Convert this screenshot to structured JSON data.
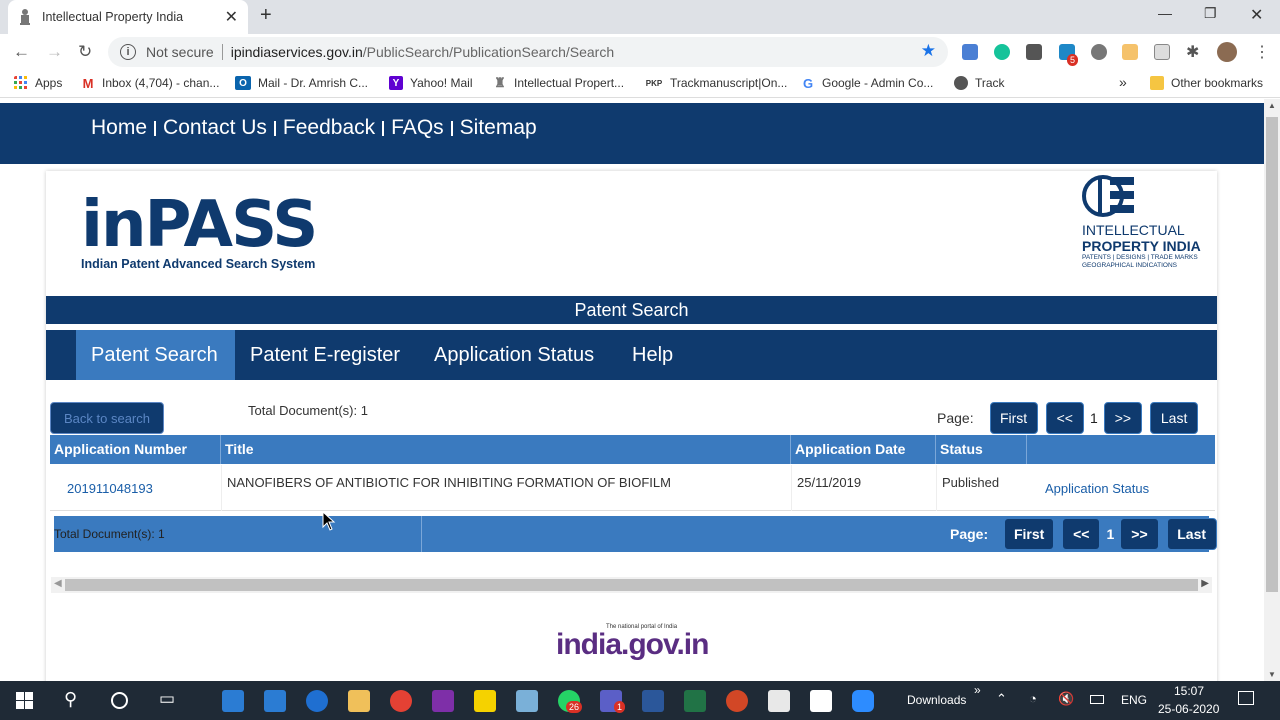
{
  "browser": {
    "tab_title": "Intellectual Property India",
    "new_tab": "+",
    "url_security": "Not secure",
    "url_host": "ipindiaservices.gov.in",
    "url_path": "/PublicSearch/PublicationSearch/Search",
    "ext_badge": "5",
    "bookmarks": [
      {
        "label": "Apps",
        "icon": "apps-grid-icon"
      },
      {
        "label": "Inbox (4,704) - chan...",
        "icon": "gmail-icon"
      },
      {
        "label": "Mail - Dr. Amrish C...",
        "icon": "outlook-icon"
      },
      {
        "label": "Yahoo! Mail",
        "icon": "yahoo-icon"
      },
      {
        "label": "Intellectual Propert...",
        "icon": "emblem-icon"
      },
      {
        "label": "Trackmanuscript|On...",
        "icon": "pkp-icon"
      },
      {
        "label": "Google - Admin Co...",
        "icon": "google-icon"
      },
      {
        "label": "Track",
        "icon": "globe-icon"
      }
    ],
    "more_bookmarks": "»",
    "other_bookmarks": "Other bookmarks"
  },
  "site": {
    "top_links": [
      "Home",
      "Contact Us",
      "Feedback",
      "FAQs",
      "Sitemap"
    ],
    "logo_title": "inPASS",
    "logo_subtitle": "Indian Patent Advanced Search System",
    "ipi_logo_line1": "INTELLECTUAL",
    "ipi_logo_line2": "PROPERTY INDIA",
    "ipi_logo_line3": "PATENTS | DESIGNS | TRADE MARKS",
    "ipi_logo_line4": "GEOGRAPHICAL INDICATIONS",
    "band_title": "Patent Search",
    "main_nav": [
      "Patent Search",
      "Patent E-register",
      "Application Status",
      "Help"
    ],
    "active_nav": "Patent Search",
    "back_button": "Back to search",
    "total_docs": "Total Document(s): 1",
    "pager": {
      "label": "Page:",
      "first": "First",
      "prev": "<<",
      "current": "1",
      "next": ">>",
      "last": "Last"
    },
    "table": {
      "headers": [
        "Application Number",
        "Title",
        "Application Date",
        "Status",
        ""
      ],
      "rows": [
        {
          "application_number": "201911048193",
          "title": "NANOFIBERS OF ANTIBIOTIC FOR INHIBITING FORMATION OF BIOFILM",
          "application_date": "25/11/2019",
          "status": "Published",
          "action": "Application Status"
        }
      ]
    },
    "footer_logo": "india.gov.in",
    "footer_logo_tagline": "The national portal of India"
  },
  "taskbar": {
    "downloads": "Downloads",
    "chevron": "»",
    "lang": "ENG",
    "time": "15:07",
    "date": "25-06-2020",
    "whatsapp_badge": "26",
    "teams_badge": "1"
  },
  "colors": {
    "navy": "#0f3a6e",
    "table_blue": "#3a7abf",
    "link_blue": "#1a5ea8"
  }
}
